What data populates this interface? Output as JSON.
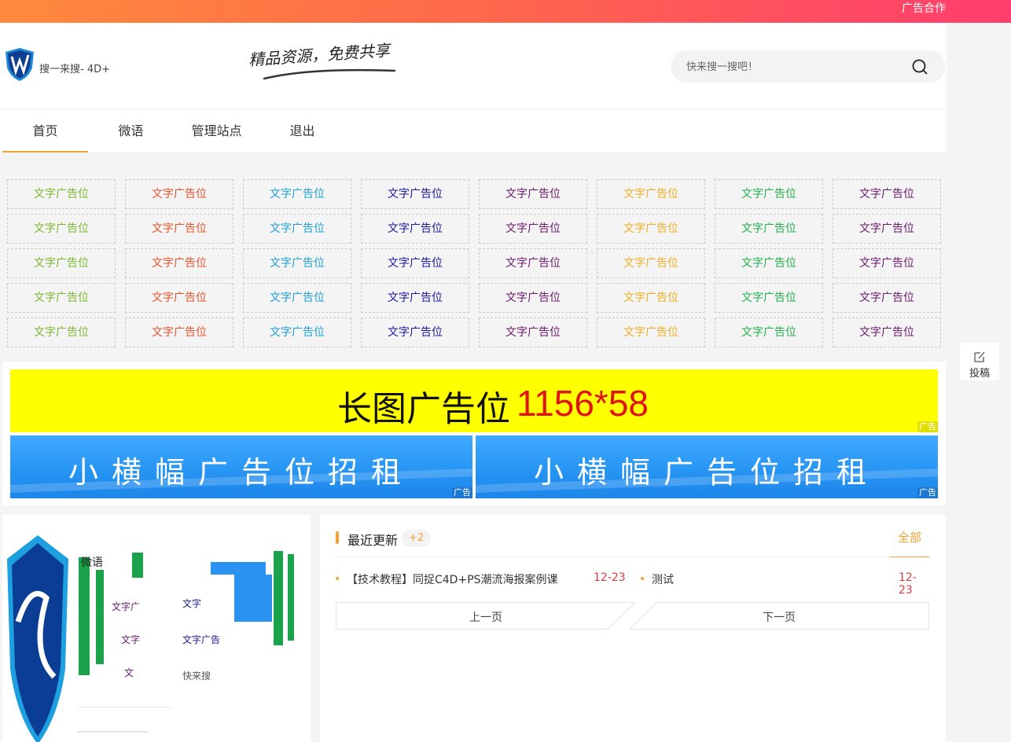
{
  "topbar": {
    "ad_coop": "广告合作"
  },
  "header": {
    "search_hint": "搜一来搜- 4D+",
    "slogan": "精品资源，免费共享",
    "search_placeholder": "快来搜一搜吧！"
  },
  "nav": [
    {
      "label": "首页",
      "active": true
    },
    {
      "label": "微语",
      "active": false
    },
    {
      "label": "管理站点",
      "active": false
    },
    {
      "label": "退出",
      "active": false
    }
  ],
  "text_ads": {
    "label": "文字广告位",
    "rows": 5,
    "column_colors": [
      "#7cb82f",
      "#e8532c",
      "#1e9fd6",
      "#1a1aa0",
      "#6b1a6e",
      "#f0ae22",
      "#22b14c",
      "#6b1a6e"
    ]
  },
  "long_banner": {
    "text": "长图广告位",
    "size": "1156*58",
    "tag": "广告"
  },
  "small_banners": [
    {
      "text": "小横幅广告位招租",
      "tag": "广告"
    },
    {
      "text": "小横幅广告位招租",
      "tag": "广告"
    }
  ],
  "side": {
    "submit": "投稿"
  },
  "left_card": {
    "weiyu": "微语",
    "labels": [
      "文字广",
      "文字",
      "文字",
      "文字广告",
      "文",
      "快来搜"
    ]
  },
  "recent": {
    "title": "最近更新",
    "count": "+2",
    "all": "全部",
    "items": [
      {
        "title": "【技术教程】同捉C4D+PS潮流海报案例课",
        "date": "12-23"
      },
      {
        "title": "测试",
        "date": "12-23"
      }
    ],
    "prev": "上一页",
    "next": "下一页"
  },
  "colors": {
    "accent": "#f5a233",
    "date_red": "#e03b3b",
    "banner_yellow": "#ffff00",
    "banner_blue": "#2b9af5"
  }
}
